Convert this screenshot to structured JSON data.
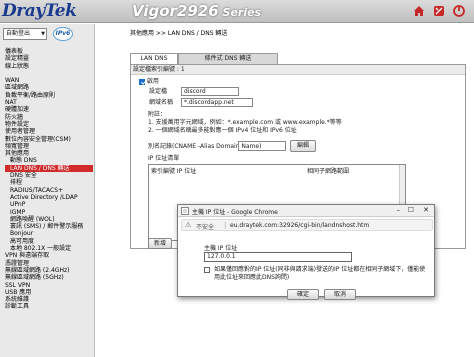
{
  "header": {
    "logo": "DrayTek",
    "model": "Vigor2926",
    "series": " Series",
    "icons": [
      "home-icon",
      "tools-icon",
      "logout-icon"
    ]
  },
  "sidebar": {
    "logout_select": "自動登出",
    "ipv6_badge": "IPv6",
    "menu": [
      {
        "label": "儀表板",
        "level": 0
      },
      {
        "label": "設定精靈",
        "level": 0
      },
      {
        "label": "線上狀態",
        "level": 0
      },
      {
        "label": "",
        "level": 0
      },
      {
        "label": "WAN",
        "level": 0
      },
      {
        "label": "區域網路",
        "level": 0
      },
      {
        "label": "負載平衡/路由原則",
        "level": 0
      },
      {
        "label": "NAT",
        "level": 0
      },
      {
        "label": "硬體加速",
        "level": 0
      },
      {
        "label": "防火牆",
        "level": 0
      },
      {
        "label": "物件設定",
        "level": 0
      },
      {
        "label": "使用者管理",
        "level": 0
      },
      {
        "label": "數位內容安全管理(CSM)",
        "level": 0
      },
      {
        "label": "頻寬管理",
        "level": 0
      },
      {
        "label": "其他應用",
        "level": 0
      },
      {
        "label": "動態 DNS",
        "level": 1
      },
      {
        "label": "LAN DNS / DNS 轉送",
        "level": 1,
        "active": true
      },
      {
        "label": "DNS 安全",
        "level": 1
      },
      {
        "label": "排程",
        "level": 1
      },
      {
        "label": "RADIUS/TACACS+",
        "level": 1
      },
      {
        "label": "Active Directory /LDAP",
        "level": 1
      },
      {
        "label": "UPnP",
        "level": 1
      },
      {
        "label": "IGMP",
        "level": 1
      },
      {
        "label": "網路喚醒 (WOL)",
        "level": 1
      },
      {
        "label": "寰訊 (SMS) / 郵件警示服務",
        "level": 1
      },
      {
        "label": "Bonjour",
        "level": 1
      },
      {
        "label": "高可用度",
        "level": 1
      },
      {
        "label": "本地 802.1X 一般設定",
        "level": 1
      },
      {
        "label": "VPN 與遠端存取",
        "level": 0
      },
      {
        "label": "憑證管理",
        "level": 0
      },
      {
        "label": "無線區域網路 (2.4GHz)",
        "level": 0
      },
      {
        "label": "無線區域網路 (5GHz)",
        "level": 0
      },
      {
        "label": "SSL VPN",
        "level": 0
      },
      {
        "label": "USB 應用",
        "level": 0
      },
      {
        "label": "系統維護",
        "level": 0
      },
      {
        "label": "診斷工具",
        "level": 0
      }
    ]
  },
  "main": {
    "breadcrumb": "其他應用 >> LAN DNS / DNS 轉送",
    "tabs": [
      {
        "label": "LAN DNS",
        "active": true
      },
      {
        "label": "條件式 DNS 轉送",
        "active": false
      }
    ],
    "panel": {
      "header": "設定檔索引編號 : 1",
      "enable_label": "啟用",
      "enable_checked": true,
      "profile_label": "設定檔",
      "profile_value": "discord",
      "domain_label": "網域名稱",
      "domain_value": "*.discordapp.net",
      "note_title": "附註：",
      "note1": "1. 支援萬用字元網域，例如：*.example.com 或 www.example.*等等",
      "note2": "2. 一個網域名稱最多能對應一個 IPv4 位址和 IPv6 位址",
      "cname_label": "別名記錄(CNAME -Alias Domain Name)",
      "cname_edit": "編輯",
      "ip_list_title": "IP 位址清單",
      "ip_list_col_ip": "索引編號 IP 位址",
      "ip_list_col_mask": "相同子網路範圍",
      "add_button": "新增"
    }
  },
  "popup": {
    "title": "主機 IP 位址 - Google Chrome",
    "insecure_label": "不安全",
    "url": "eu.draytek.com:32926/cgi-bin/landnshost.htm",
    "host_ip_label": "主機 IP 位址",
    "host_ip_value": "127.0.0.1",
    "same_subnet_text": "如果僅回應對的IP 位址(同非與請求端)發送的IP 位址都在相同子網域下，僅能使用此位址來回應此DNS詢問)",
    "ok_button": "確定",
    "cancel_button": "取消"
  }
}
